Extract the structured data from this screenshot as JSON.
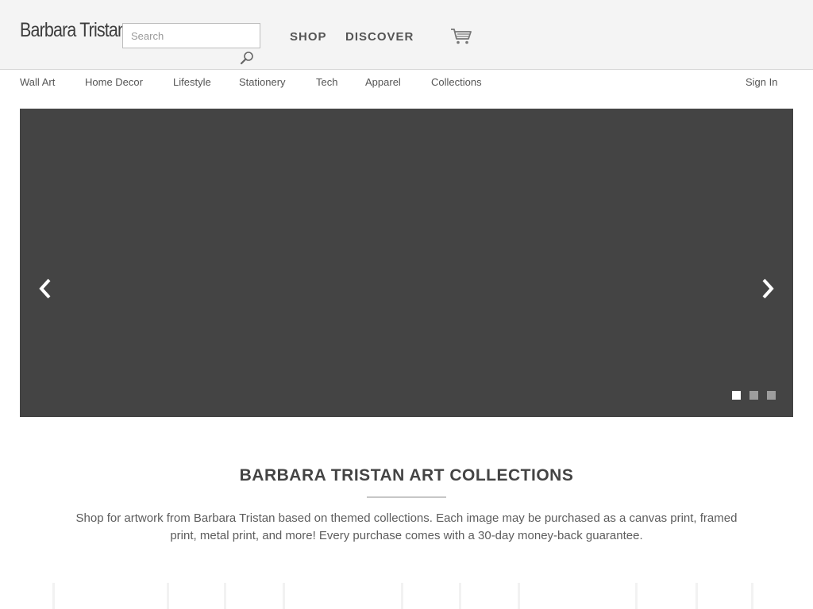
{
  "header": {
    "logo": "Barbara Tristan",
    "search": {
      "placeholder": "Search",
      "value": ""
    },
    "nav": [
      {
        "label": "SHOP"
      },
      {
        "label": "DISCOVER"
      }
    ]
  },
  "categories": [
    {
      "label": "Wall Art"
    },
    {
      "label": "Home Decor"
    },
    {
      "label": "Lifestyle"
    },
    {
      "label": "Stationery"
    },
    {
      "label": "Tech"
    },
    {
      "label": "Apparel"
    },
    {
      "label": "Collections"
    }
  ],
  "account": {
    "sign_in": "Sign In"
  },
  "slider": {
    "slides": 3,
    "active_slide": 1,
    "background": "#444444"
  },
  "collections": {
    "title": "BARBARA TRISTAN ART COLLECTIONS",
    "description": "Shop for artwork from Barbara Tristan based on themed collections. Each image may be purchased as a canvas print, framed print, metal print, and more! Every purchase comes with a 30-day money-back guarantee."
  },
  "icons": [
    "search-icon",
    "cart-icon",
    "chevron-left-icon",
    "chevron-right-icon"
  ],
  "colors": {
    "header_bg": "#f4f4f4",
    "text": "#444444",
    "slider_bg": "#444444"
  }
}
